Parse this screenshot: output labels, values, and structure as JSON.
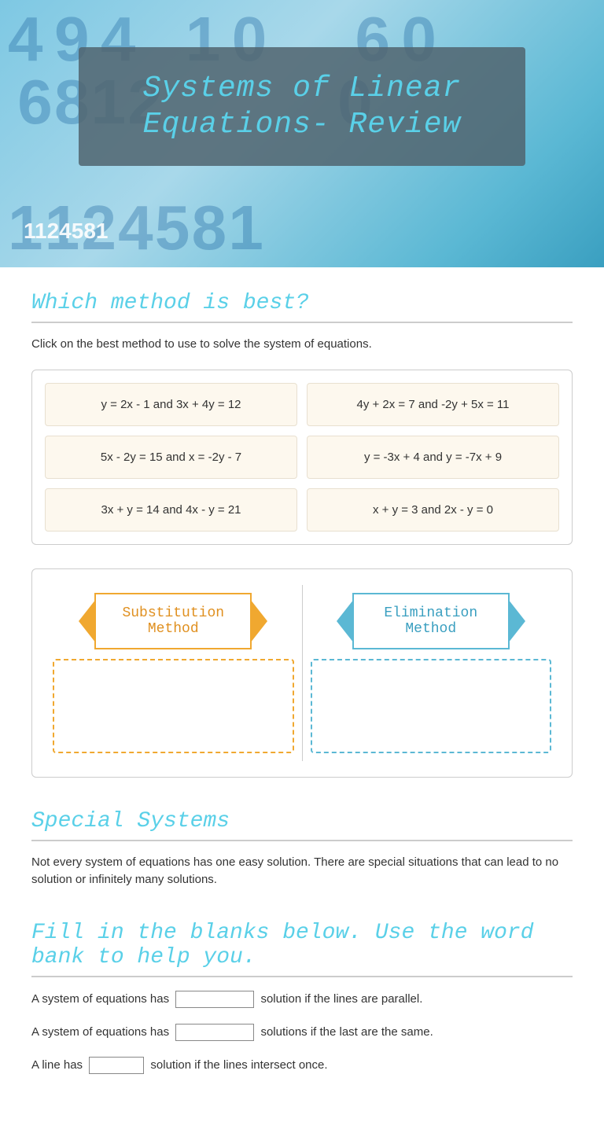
{
  "header": {
    "title": "Systems of Linear Equations- Review",
    "bg_numbers": "4 9 4 1 0 6 0 6 8 1 2 1 1 2 4 5 8 1 1 1 2 4 5 8 1 5 2 4 5 8"
  },
  "which_method": {
    "heading": "Which method is best?",
    "description": "Click on the best method to use to solve the system of equations.",
    "equations": [
      {
        "row": [
          "y = 2x - 1  and  3x + 4y = 12",
          "4y + 2x = 7  and  -2y + 5x = 11"
        ]
      },
      {
        "row": [
          "5x - 2y = 15  and  x = -2y - 7",
          "y = -3x + 4 and y = -7x + 9"
        ]
      },
      {
        "row": [
          "3x + y = 14  and  4x - y = 21",
          "x + y = 3  and  2x - y = 0"
        ]
      }
    ]
  },
  "methods": {
    "substitution_label": "Substitution Method",
    "elimination_label": "Elimination Method"
  },
  "special_systems": {
    "heading": "Special Systems",
    "description": "Not every system of equations has one easy solution.  There are special situations that can lead to no solution or infinitely many solutions."
  },
  "fill_blanks": {
    "heading": "Fill in the blanks below. Use the word bank to help you.",
    "lines": [
      {
        "before": "A system of equations has",
        "blank_size": "medium",
        "after": "solution if the lines are parallel."
      },
      {
        "before": "A system of equations has",
        "blank_size": "medium",
        "after": "solutions if the last are the same."
      },
      {
        "before": "A line has",
        "blank_size": "small",
        "after": "solution if the lines intersect once."
      }
    ]
  }
}
